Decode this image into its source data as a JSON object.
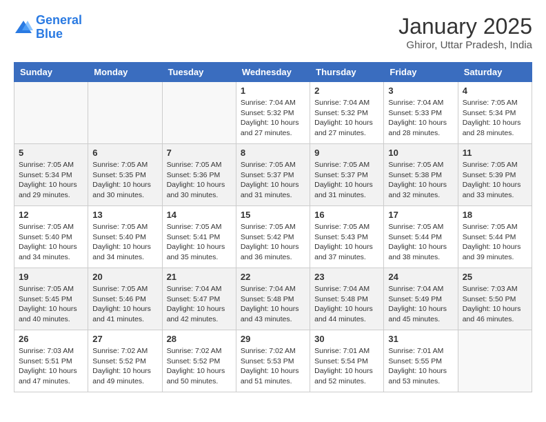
{
  "logo": {
    "line1": "General",
    "line2": "Blue"
  },
  "title": "January 2025",
  "location": "Ghiror, Uttar Pradesh, India",
  "headers": [
    "Sunday",
    "Monday",
    "Tuesday",
    "Wednesday",
    "Thursday",
    "Friday",
    "Saturday"
  ],
  "weeks": [
    [
      {
        "num": "",
        "sunrise": "",
        "sunset": "",
        "daylight": ""
      },
      {
        "num": "",
        "sunrise": "",
        "sunset": "",
        "daylight": ""
      },
      {
        "num": "",
        "sunrise": "",
        "sunset": "",
        "daylight": ""
      },
      {
        "num": "1",
        "sunrise": "Sunrise: 7:04 AM",
        "sunset": "Sunset: 5:32 PM",
        "daylight": "Daylight: 10 hours and 27 minutes."
      },
      {
        "num": "2",
        "sunrise": "Sunrise: 7:04 AM",
        "sunset": "Sunset: 5:32 PM",
        "daylight": "Daylight: 10 hours and 27 minutes."
      },
      {
        "num": "3",
        "sunrise": "Sunrise: 7:04 AM",
        "sunset": "Sunset: 5:33 PM",
        "daylight": "Daylight: 10 hours and 28 minutes."
      },
      {
        "num": "4",
        "sunrise": "Sunrise: 7:05 AM",
        "sunset": "Sunset: 5:34 PM",
        "daylight": "Daylight: 10 hours and 28 minutes."
      }
    ],
    [
      {
        "num": "5",
        "sunrise": "Sunrise: 7:05 AM",
        "sunset": "Sunset: 5:34 PM",
        "daylight": "Daylight: 10 hours and 29 minutes."
      },
      {
        "num": "6",
        "sunrise": "Sunrise: 7:05 AM",
        "sunset": "Sunset: 5:35 PM",
        "daylight": "Daylight: 10 hours and 30 minutes."
      },
      {
        "num": "7",
        "sunrise": "Sunrise: 7:05 AM",
        "sunset": "Sunset: 5:36 PM",
        "daylight": "Daylight: 10 hours and 30 minutes."
      },
      {
        "num": "8",
        "sunrise": "Sunrise: 7:05 AM",
        "sunset": "Sunset: 5:37 PM",
        "daylight": "Daylight: 10 hours and 31 minutes."
      },
      {
        "num": "9",
        "sunrise": "Sunrise: 7:05 AM",
        "sunset": "Sunset: 5:37 PM",
        "daylight": "Daylight: 10 hours and 31 minutes."
      },
      {
        "num": "10",
        "sunrise": "Sunrise: 7:05 AM",
        "sunset": "Sunset: 5:38 PM",
        "daylight": "Daylight: 10 hours and 32 minutes."
      },
      {
        "num": "11",
        "sunrise": "Sunrise: 7:05 AM",
        "sunset": "Sunset: 5:39 PM",
        "daylight": "Daylight: 10 hours and 33 minutes."
      }
    ],
    [
      {
        "num": "12",
        "sunrise": "Sunrise: 7:05 AM",
        "sunset": "Sunset: 5:40 PM",
        "daylight": "Daylight: 10 hours and 34 minutes."
      },
      {
        "num": "13",
        "sunrise": "Sunrise: 7:05 AM",
        "sunset": "Sunset: 5:40 PM",
        "daylight": "Daylight: 10 hours and 34 minutes."
      },
      {
        "num": "14",
        "sunrise": "Sunrise: 7:05 AM",
        "sunset": "Sunset: 5:41 PM",
        "daylight": "Daylight: 10 hours and 35 minutes."
      },
      {
        "num": "15",
        "sunrise": "Sunrise: 7:05 AM",
        "sunset": "Sunset: 5:42 PM",
        "daylight": "Daylight: 10 hours and 36 minutes."
      },
      {
        "num": "16",
        "sunrise": "Sunrise: 7:05 AM",
        "sunset": "Sunset: 5:43 PM",
        "daylight": "Daylight: 10 hours and 37 minutes."
      },
      {
        "num": "17",
        "sunrise": "Sunrise: 7:05 AM",
        "sunset": "Sunset: 5:44 PM",
        "daylight": "Daylight: 10 hours and 38 minutes."
      },
      {
        "num": "18",
        "sunrise": "Sunrise: 7:05 AM",
        "sunset": "Sunset: 5:44 PM",
        "daylight": "Daylight: 10 hours and 39 minutes."
      }
    ],
    [
      {
        "num": "19",
        "sunrise": "Sunrise: 7:05 AM",
        "sunset": "Sunset: 5:45 PM",
        "daylight": "Daylight: 10 hours and 40 minutes."
      },
      {
        "num": "20",
        "sunrise": "Sunrise: 7:05 AM",
        "sunset": "Sunset: 5:46 PM",
        "daylight": "Daylight: 10 hours and 41 minutes."
      },
      {
        "num": "21",
        "sunrise": "Sunrise: 7:04 AM",
        "sunset": "Sunset: 5:47 PM",
        "daylight": "Daylight: 10 hours and 42 minutes."
      },
      {
        "num": "22",
        "sunrise": "Sunrise: 7:04 AM",
        "sunset": "Sunset: 5:48 PM",
        "daylight": "Daylight: 10 hours and 43 minutes."
      },
      {
        "num": "23",
        "sunrise": "Sunrise: 7:04 AM",
        "sunset": "Sunset: 5:48 PM",
        "daylight": "Daylight: 10 hours and 44 minutes."
      },
      {
        "num": "24",
        "sunrise": "Sunrise: 7:04 AM",
        "sunset": "Sunset: 5:49 PM",
        "daylight": "Daylight: 10 hours and 45 minutes."
      },
      {
        "num": "25",
        "sunrise": "Sunrise: 7:03 AM",
        "sunset": "Sunset: 5:50 PM",
        "daylight": "Daylight: 10 hours and 46 minutes."
      }
    ],
    [
      {
        "num": "26",
        "sunrise": "Sunrise: 7:03 AM",
        "sunset": "Sunset: 5:51 PM",
        "daylight": "Daylight: 10 hours and 47 minutes."
      },
      {
        "num": "27",
        "sunrise": "Sunrise: 7:02 AM",
        "sunset": "Sunset: 5:52 PM",
        "daylight": "Daylight: 10 hours and 49 minutes."
      },
      {
        "num": "28",
        "sunrise": "Sunrise: 7:02 AM",
        "sunset": "Sunset: 5:52 PM",
        "daylight": "Daylight: 10 hours and 50 minutes."
      },
      {
        "num": "29",
        "sunrise": "Sunrise: 7:02 AM",
        "sunset": "Sunset: 5:53 PM",
        "daylight": "Daylight: 10 hours and 51 minutes."
      },
      {
        "num": "30",
        "sunrise": "Sunrise: 7:01 AM",
        "sunset": "Sunset: 5:54 PM",
        "daylight": "Daylight: 10 hours and 52 minutes."
      },
      {
        "num": "31",
        "sunrise": "Sunrise: 7:01 AM",
        "sunset": "Sunset: 5:55 PM",
        "daylight": "Daylight: 10 hours and 53 minutes."
      },
      {
        "num": "",
        "sunrise": "",
        "sunset": "",
        "daylight": ""
      }
    ]
  ]
}
